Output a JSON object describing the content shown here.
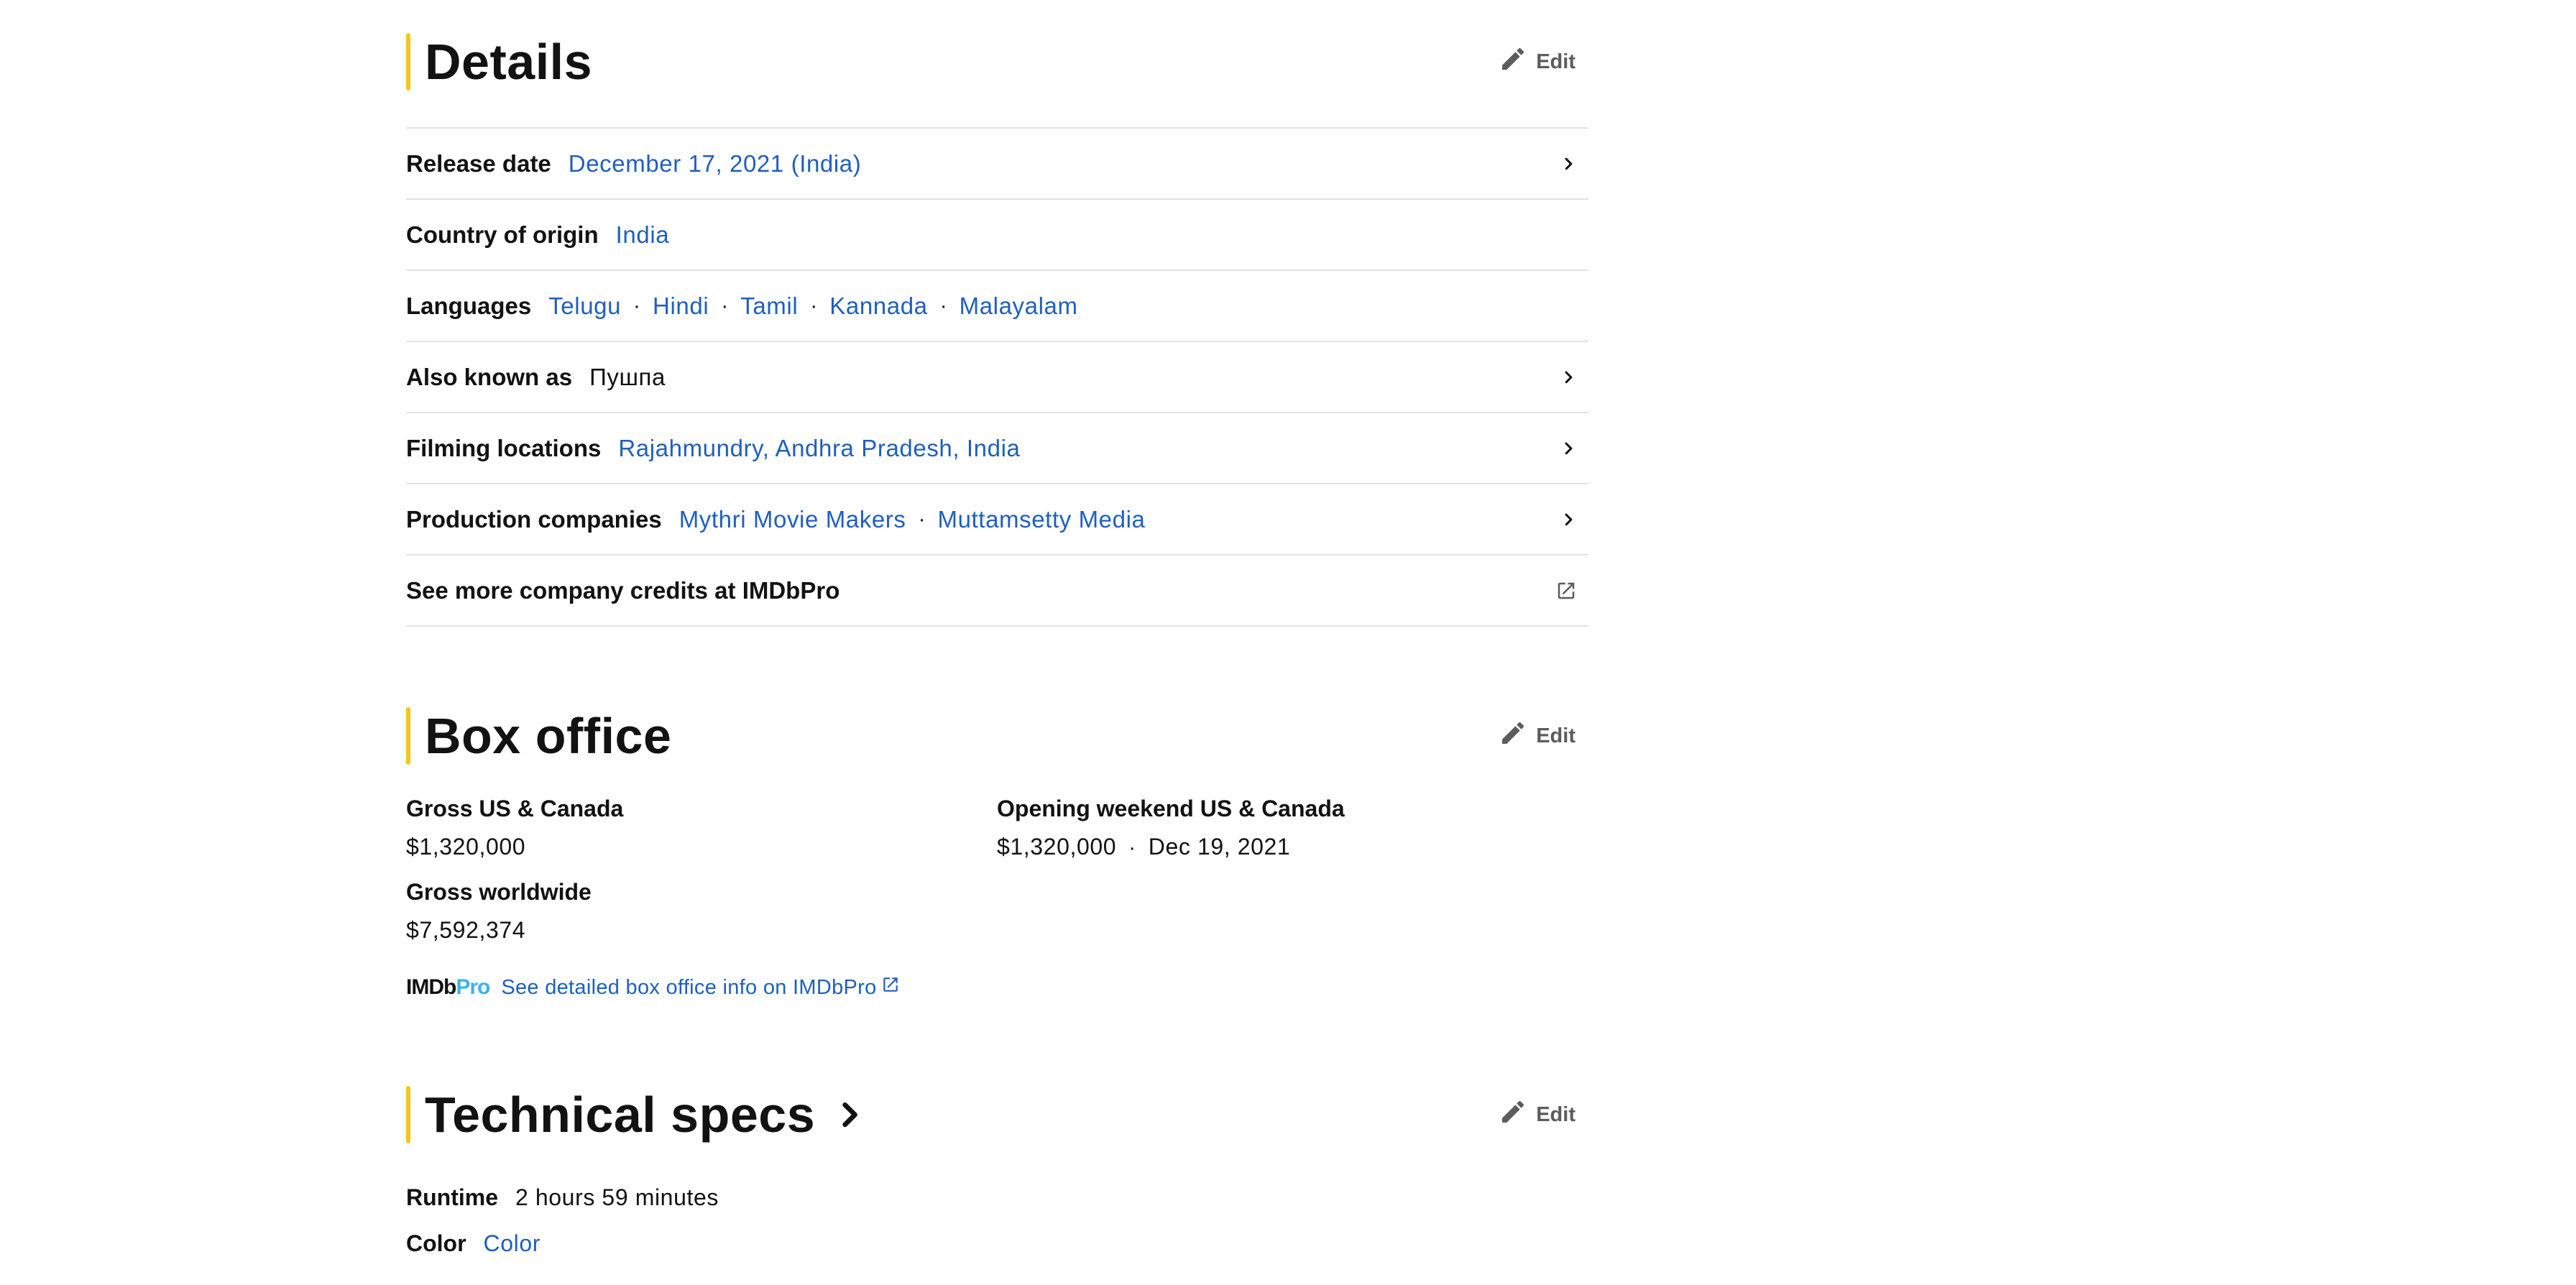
{
  "details": {
    "title": "Details",
    "edit_label": "Edit",
    "rows": [
      {
        "label": "Release date",
        "values": [
          "December 17, 2021 (India)"
        ]
      },
      {
        "label": "Country of origin",
        "values": [
          "India"
        ]
      },
      {
        "label": "Languages",
        "values": [
          "Telugu",
          "Hindi",
          "Tamil",
          "Kannada",
          "Malayalam"
        ]
      },
      {
        "label": "Also known as",
        "values": [
          "Пушпа"
        ]
      },
      {
        "label": "Filming locations",
        "values": [
          "Rajahmundry, Andhra Pradesh, India"
        ]
      },
      {
        "label": "Production companies",
        "values": [
          "Mythri Movie Makers",
          "Muttamsetty Media"
        ]
      }
    ],
    "more_credits_label": "See more company credits at IMDbPro"
  },
  "box_office": {
    "title": "Box office",
    "edit_label": "Edit",
    "gross_us_label": "Gross US & Canada",
    "gross_us_value": "$1,320,000",
    "opening_label": "Opening weekend US & Canada",
    "opening_value": "$1,320,000",
    "opening_date": "Dec 19, 2021",
    "gross_world_label": "Gross worldwide",
    "gross_world_value": "$7,592,374",
    "pro_logo_imdb": "IMDb",
    "pro_logo_pro": "Pro",
    "pro_link": "See detailed box office info on IMDbPro"
  },
  "tech_specs": {
    "title": "Technical specs",
    "edit_label": "Edit",
    "runtime_label": "Runtime",
    "runtime_value": "2 hours 59 minutes",
    "color_label": "Color",
    "color_value": "Color"
  },
  "colors": {
    "accent": "#f5c518",
    "link": "#1f5fbf",
    "text": "#121212",
    "muted": "#5c5c5c",
    "divider": "#e3e3e3",
    "pro_blue": "#3db3e8"
  },
  "icons": {
    "edit": "pencil-icon",
    "row_arrow": "chevron-right-icon",
    "external": "external-link-icon"
  }
}
